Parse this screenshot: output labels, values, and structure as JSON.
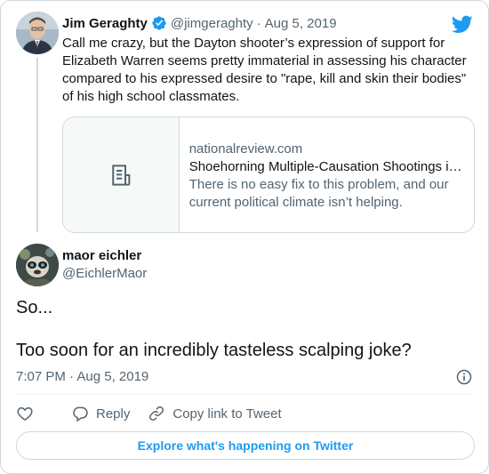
{
  "parent_tweet": {
    "name": "Jim Geraghty",
    "handle": "@jimgeraghty",
    "separator": "·",
    "date": "Aug 5, 2019",
    "text": "Call me crazy, but the Dayton shooter’s expression of support for Elizabeth Warren seems pretty immaterial in assessing his character compared to his expressed desire to \"rape, kill and skin their bodies\" of his high school classmates.",
    "link_card": {
      "domain": "nationalreview.com",
      "title": "Shoehorning Multiple-Causation Shootings i…",
      "description": "There is no easy fix to this problem, and our current political climate isn’t helping.",
      "thumbnail_icon": "article-icon"
    }
  },
  "reply_tweet": {
    "name": "maor eichler",
    "handle": "@EichlerMaor",
    "text": "So...\n\nToo soon for an incredibly tasteless scalping joke?",
    "timestamp": "7:07 PM · Aug 5, 2019"
  },
  "actions": {
    "like_icon": "heart-icon",
    "reply_label": "Reply",
    "copy_link_label": "Copy link to Tweet"
  },
  "explore_button": "Explore what's happening on Twitter",
  "colors": {
    "accent": "#1d9bf0",
    "text": "#0f1419",
    "muted": "#536471",
    "border": "#cfd9de"
  }
}
